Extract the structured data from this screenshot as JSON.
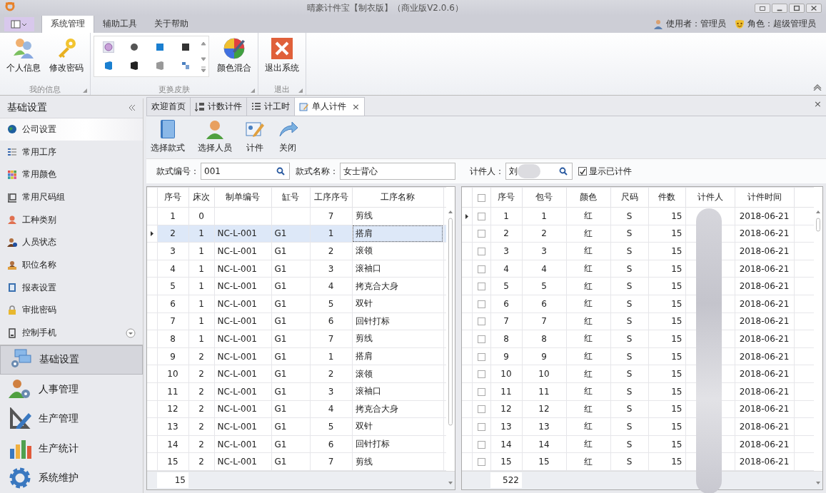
{
  "window": {
    "title": "晴豪计件宝【制衣版】（商业版V2.0.6）"
  },
  "ribbon_tabs": [
    {
      "label": "系统管理",
      "selected": true
    },
    {
      "label": "辅助工具",
      "selected": false
    },
    {
      "label": "关于帮助",
      "selected": false
    }
  ],
  "user_info": {
    "user": "使用者：管理员",
    "role": "角色：超级管理员"
  },
  "ribbon_groups": [
    {
      "label": "我的信息",
      "kind": "buttons",
      "buttons": [
        "个人信息",
        "修改密码"
      ]
    },
    {
      "label": "更换皮肤",
      "kind": "gallery",
      "buttons": [
        "颜色混合"
      ]
    },
    {
      "label": "退出",
      "kind": "buttons",
      "buttons": [
        "退出系统"
      ]
    }
  ],
  "sidebar": {
    "title": "基础设置",
    "items": [
      {
        "label": "公司设置",
        "selected": true
      },
      {
        "label": "常用工序",
        "selected": false
      },
      {
        "label": "常用颜色",
        "selected": false
      },
      {
        "label": "常用尺码组",
        "selected": false
      },
      {
        "label": "工种类别",
        "selected": false
      },
      {
        "label": "人员状态",
        "selected": false
      },
      {
        "label": "职位名称",
        "selected": false
      },
      {
        "label": "报表设置",
        "selected": false
      },
      {
        "label": "审批密码",
        "selected": false
      },
      {
        "label": "控制手机",
        "selected": false
      }
    ],
    "nav": [
      {
        "label": "基础设置",
        "selected": true
      },
      {
        "label": "人事管理",
        "selected": false
      },
      {
        "label": "生产管理",
        "selected": false
      },
      {
        "label": "生产统计",
        "selected": false
      },
      {
        "label": "系统维护",
        "selected": false
      }
    ]
  },
  "doc_tabs": [
    {
      "label": "欢迎首页",
      "selected": false,
      "closable": false
    },
    {
      "label": "计数计件",
      "selected": false,
      "closable": false
    },
    {
      "label": "计工时",
      "selected": false,
      "closable": false
    },
    {
      "label": "单人计件",
      "selected": true,
      "closable": true
    }
  ],
  "close_glyph": "×",
  "toolbar": [
    "选择款式",
    "选择人员",
    "计件",
    "关闭"
  ],
  "filters": {
    "style_no": {
      "label": "款式编号：",
      "value": "001"
    },
    "style_name": {
      "label": "款式名称：",
      "value": "女士背心"
    },
    "worker": {
      "label": "计件人：",
      "value": "刘"
    },
    "show_counted": {
      "label": "显示已计件",
      "checked": true
    }
  },
  "process_table": {
    "columns": [
      "序号",
      "床次",
      "制单编号",
      "缸号",
      "工序序号",
      "工序名称"
    ],
    "rows": [
      {
        "cells": [
          "1",
          "0",
          "",
          "",
          "7",
          "剪线"
        ],
        "selected": false
      },
      {
        "cells": [
          "2",
          "1",
          "NC-L-001",
          "G1",
          "1",
          "搭肩"
        ],
        "selected": true
      },
      {
        "cells": [
          "3",
          "1",
          "NC-L-001",
          "G1",
          "2",
          "滚领"
        ],
        "selected": false
      },
      {
        "cells": [
          "4",
          "1",
          "NC-L-001",
          "G1",
          "3",
          "滚袖口"
        ],
        "selected": false
      },
      {
        "cells": [
          "5",
          "1",
          "NC-L-001",
          "G1",
          "4",
          "拷克合大身"
        ],
        "selected": false
      },
      {
        "cells": [
          "6",
          "1",
          "NC-L-001",
          "G1",
          "5",
          "双针"
        ],
        "selected": false
      },
      {
        "cells": [
          "7",
          "1",
          "NC-L-001",
          "G1",
          "6",
          "回针打标"
        ],
        "selected": false
      },
      {
        "cells": [
          "8",
          "1",
          "NC-L-001",
          "G1",
          "7",
          "剪线"
        ],
        "selected": false
      },
      {
        "cells": [
          "9",
          "2",
          "NC-L-001",
          "G1",
          "1",
          "搭肩"
        ],
        "selected": false
      },
      {
        "cells": [
          "10",
          "2",
          "NC-L-001",
          "G1",
          "2",
          "滚领"
        ],
        "selected": false
      },
      {
        "cells": [
          "11",
          "2",
          "NC-L-001",
          "G1",
          "3",
          "滚袖口"
        ],
        "selected": false
      },
      {
        "cells": [
          "12",
          "2",
          "NC-L-001",
          "G1",
          "4",
          "拷克合大身"
        ],
        "selected": false
      },
      {
        "cells": [
          "13",
          "2",
          "NC-L-001",
          "G1",
          "5",
          "双针"
        ],
        "selected": false
      },
      {
        "cells": [
          "14",
          "2",
          "NC-L-001",
          "G1",
          "6",
          "回针打标"
        ],
        "selected": false
      },
      {
        "cells": [
          "15",
          "2",
          "NC-L-001",
          "G1",
          "7",
          "剪线"
        ],
        "selected": false
      }
    ],
    "footer": "15"
  },
  "record_table": {
    "all_checked": false,
    "columns": [
      "序号",
      "包号",
      "颜色",
      "尺码",
      "件数",
      "计件人",
      "计件时间"
    ],
    "rows": [
      {
        "cells": [
          "1",
          "1",
          "红",
          "S",
          "15",
          "",
          "2018-06-21"
        ],
        "checked": false,
        "selected": true
      },
      {
        "cells": [
          "2",
          "2",
          "红",
          "S",
          "15",
          "",
          "2018-06-21"
        ],
        "checked": false,
        "selected": false
      },
      {
        "cells": [
          "3",
          "3",
          "红",
          "S",
          "15",
          "",
          "2018-06-21"
        ],
        "checked": false,
        "selected": false
      },
      {
        "cells": [
          "4",
          "4",
          "红",
          "S",
          "15",
          "",
          "2018-06-21"
        ],
        "checked": false,
        "selected": false
      },
      {
        "cells": [
          "5",
          "5",
          "红",
          "S",
          "15",
          "",
          "2018-06-21"
        ],
        "checked": false,
        "selected": false
      },
      {
        "cells": [
          "6",
          "6",
          "红",
          "S",
          "15",
          "",
          "2018-06-21"
        ],
        "checked": false,
        "selected": false
      },
      {
        "cells": [
          "7",
          "7",
          "红",
          "S",
          "15",
          "",
          "2018-06-21"
        ],
        "checked": false,
        "selected": false
      },
      {
        "cells": [
          "8",
          "8",
          "红",
          "S",
          "15",
          "",
          "2018-06-21"
        ],
        "checked": false,
        "selected": false
      },
      {
        "cells": [
          "9",
          "9",
          "红",
          "S",
          "15",
          "",
          "2018-06-21"
        ],
        "checked": false,
        "selected": false
      },
      {
        "cells": [
          "10",
          "10",
          "红",
          "S",
          "15",
          "",
          "2018-06-21"
        ],
        "checked": false,
        "selected": false
      },
      {
        "cells": [
          "11",
          "11",
          "红",
          "S",
          "15",
          "",
          "2018-06-21"
        ],
        "checked": false,
        "selected": false
      },
      {
        "cells": [
          "12",
          "12",
          "红",
          "S",
          "15",
          "",
          "2018-06-21"
        ],
        "checked": false,
        "selected": false
      },
      {
        "cells": [
          "13",
          "13",
          "红",
          "S",
          "15",
          "",
          "2018-06-21"
        ],
        "checked": false,
        "selected": false
      },
      {
        "cells": [
          "14",
          "14",
          "红",
          "S",
          "15",
          "",
          "2018-06-21"
        ],
        "checked": false,
        "selected": false
      },
      {
        "cells": [
          "15",
          "15",
          "红",
          "S",
          "15",
          "",
          "2018-06-21"
        ],
        "checked": false,
        "selected": false
      }
    ],
    "footer": "522"
  }
}
